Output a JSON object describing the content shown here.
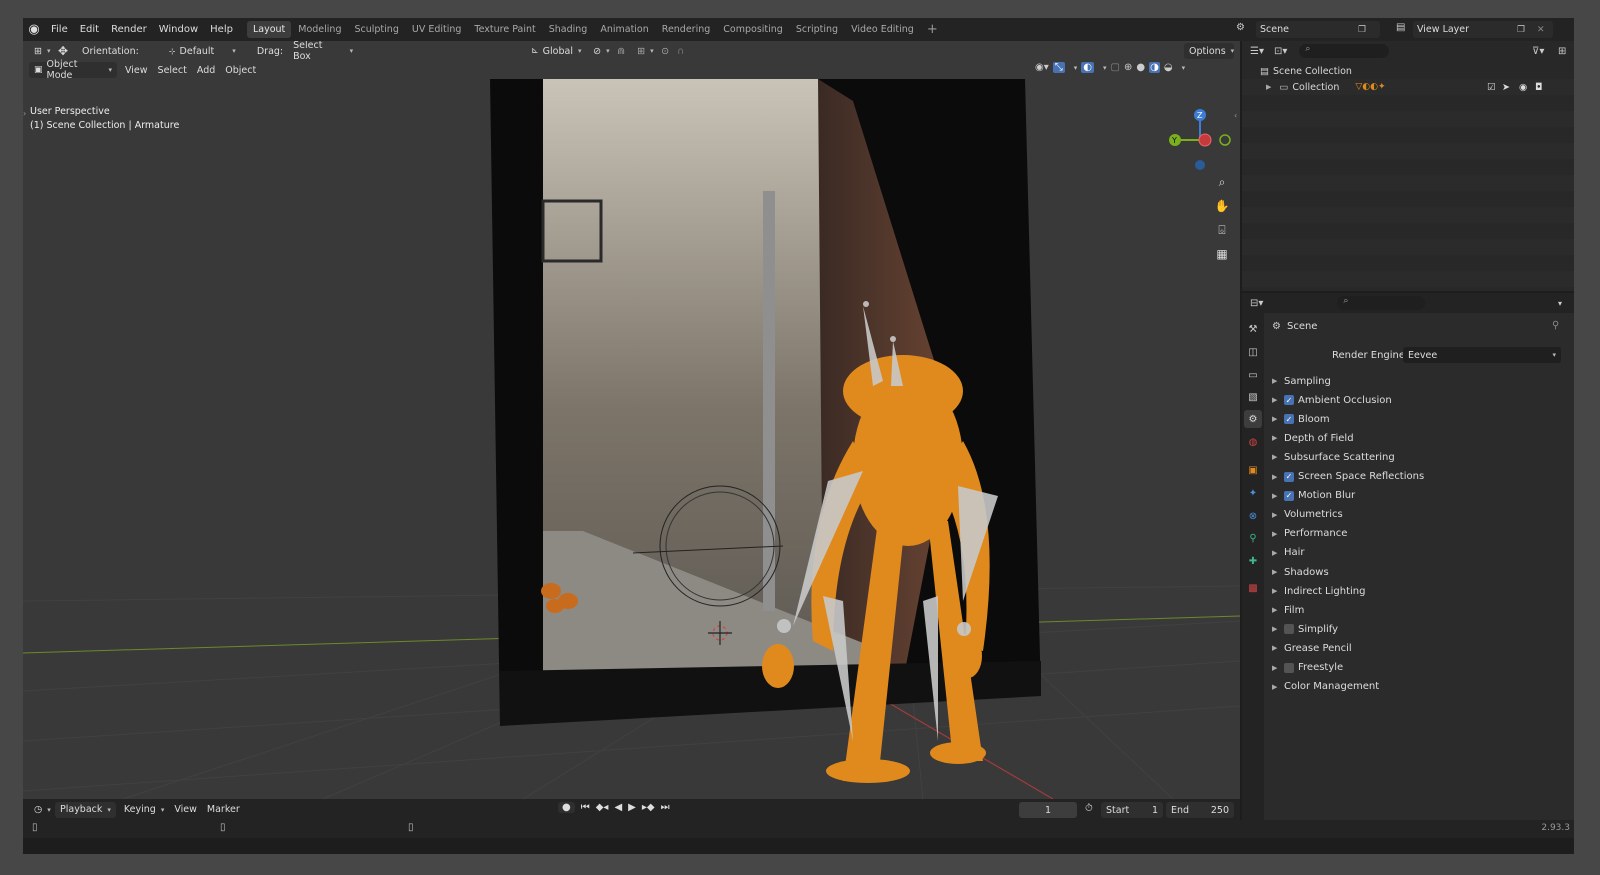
{
  "menu": [
    "File",
    "Edit",
    "Render",
    "Window",
    "Help"
  ],
  "workspaces": [
    "Layout",
    "Modeling",
    "Sculpting",
    "UV Editing",
    "Texture Paint",
    "Shading",
    "Animation",
    "Rendering",
    "Compositing",
    "Scripting",
    "Video Editing"
  ],
  "active_workspace": "Layout",
  "scene_name": "Scene",
  "view_layer": "View Layer",
  "tool_header": {
    "orientation_label": "Orientation:",
    "orientation_value": "Default",
    "drag_label": "Drag:",
    "drag_value": "Select Box",
    "transform_orientation": "Global",
    "options": "Options"
  },
  "viewport_header": {
    "mode": "Object Mode",
    "menus": [
      "View",
      "Select",
      "Add",
      "Object"
    ]
  },
  "viewport": {
    "perspective": "User Perspective",
    "context": "(1) Scene Collection | Armature"
  },
  "gizmo": {
    "z": "Z",
    "y": "Y"
  },
  "timeline": {
    "menus": [
      "Playback",
      "Keying",
      "View",
      "Marker"
    ],
    "current_frame": "1",
    "start_label": "Start",
    "start": "1",
    "end_label": "End",
    "end": "250"
  },
  "status": {
    "version": "2.93.3"
  },
  "outliner": {
    "root": "Scene Collection",
    "collection": "Collection"
  },
  "properties": {
    "context": "Scene",
    "render_engine_label": "Render Engine",
    "render_engine": "Eevee",
    "panels": [
      {
        "label": "Sampling",
        "check": null
      },
      {
        "label": "Ambient Occlusion",
        "check": true
      },
      {
        "label": "Bloom",
        "check": true
      },
      {
        "label": "Depth of Field",
        "check": null
      },
      {
        "label": "Subsurface Scattering",
        "check": null
      },
      {
        "label": "Screen Space Reflections",
        "check": true
      },
      {
        "label": "Motion Blur",
        "check": true
      },
      {
        "label": "Volumetrics",
        "check": null
      },
      {
        "label": "Performance",
        "check": null
      },
      {
        "label": "Hair",
        "check": null
      },
      {
        "label": "Shadows",
        "check": null
      },
      {
        "label": "Indirect Lighting",
        "check": null
      },
      {
        "label": "Film",
        "check": null
      },
      {
        "label": "Simplify",
        "check": false
      },
      {
        "label": "Grease Pencil",
        "check": null
      },
      {
        "label": "Freestyle",
        "check": false
      },
      {
        "label": "Color Management",
        "check": null
      }
    ]
  },
  "colors": {
    "accent": "#4772b3",
    "character": "#e08a1e",
    "x_axis": "#c53a3a",
    "y_axis": "#79b01c",
    "z_axis": "#3c7dd6"
  }
}
